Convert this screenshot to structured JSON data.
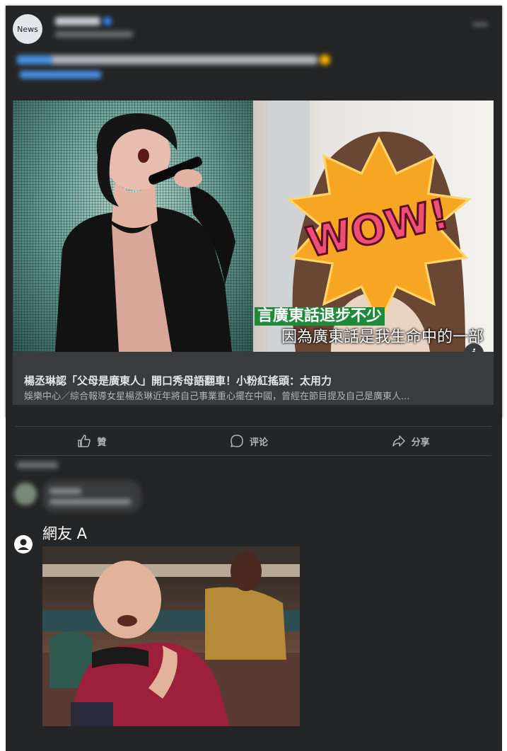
{
  "post": {
    "avatar_text": "News",
    "page_name": "",
    "link_title": "楊丞琳認「父母是廣東人」開口秀母語翻車！小粉紅搖頭：太用力",
    "link_description": "娛樂中心／綜合報導女星楊丞琳近年將自己事業重心擺在中國，曾經在節目提及自己是廣東人...",
    "image_caption_line1": "言廣東話退步不少",
    "image_caption_line2": "因為廣東話是我生命中的一部",
    "sticker_text": "WOW!"
  },
  "actions": {
    "like": "贊",
    "comment": "评论",
    "share": "分享"
  },
  "comment": {
    "author": "網友 A"
  },
  "colors": {
    "panel": "#242526",
    "link_box": "#3a3b3c",
    "text_primary": "#e4e6eb",
    "text_secondary": "#b0b3b8",
    "sticker_orange": "#f6a623",
    "sticker_pink": "#ef4f77"
  },
  "icons": {
    "like": "thumbs-up-icon",
    "comment": "speech-bubble-icon",
    "share": "share-arrow-icon",
    "info": "info-icon",
    "user": "user-avatar-icon"
  }
}
